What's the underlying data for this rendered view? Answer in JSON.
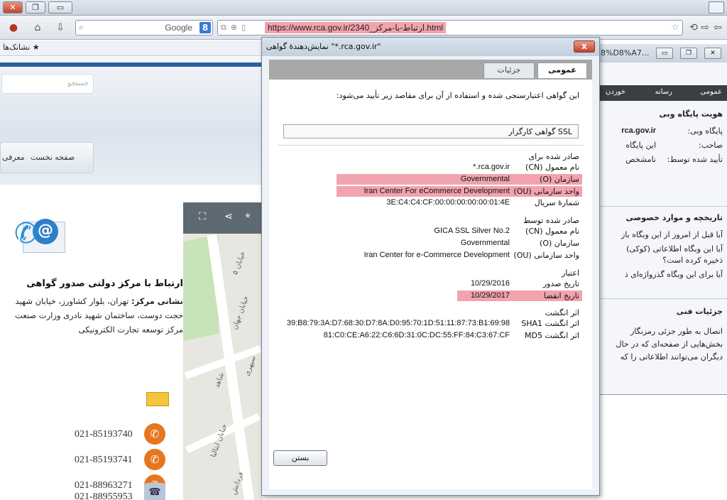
{
  "browser": {
    "url": "https://www.rca.gov.ir/2340_ارتباط-با-مرکز.html",
    "search_engine": "Google",
    "search_button": "8",
    "bookmarks_label": "نشانک‌ها"
  },
  "background_page": {
    "search_placeholder": "جستجو",
    "menu_home": "صفحه نخست",
    "menu_intro": "معرفی",
    "contact_title": "ارتباط با مرکز دولتی صدور گواهی",
    "address_label": "نشانی مرکز:",
    "address_line1": " تهران، بلوار کشاورز، خیابان شهید",
    "address_line2": "حجت دوست، ساختمان شهید نادری وزارت صنعت",
    "address_line3": "مرکز توسعه تجارت الکترونیکی",
    "phones": [
      "021-85193740",
      "021-85193741",
      "021-88963271"
    ],
    "fax": "021-88955953",
    "map_streets": [
      "خیابان ۵",
      "خیابان جهان",
      "شاهد",
      "خیابان ابتالیا",
      "فردانش",
      "سپهری"
    ]
  },
  "page_info_window": {
    "title": "8%D8%A7...",
    "tabs": [
      "عمومی",
      "رسانه",
      "خوردن"
    ],
    "identity_heading": "هویت پایگاه وبی",
    "website_label": "پایگاه وبی:",
    "website_value": "rca.gov.ir",
    "owner_label": "صاحب:",
    "owner_value": "این پایگاه",
    "verified_label": "تأیید شده توسط:",
    "verified_value": "نامشخص",
    "history_heading": "تاریخچه و موارد خصوصی",
    "history_q1": "آیا قبل از امروز از این وبگاه باز",
    "history_q2": "آیا این وبگاه اطلاعاتی (کوکی)",
    "history_q2b": "ذخیره کرده است؟",
    "history_q3": "آیا برای این وبگاه گذرواژه‌ای ذ",
    "tech_heading": "جزئیات فنی",
    "tech_l1": "اتصال به طور جزئی رمزنگار",
    "tech_l2": "بخش‌هایی از صفحه‌ای که در حال",
    "tech_l3": "دیگران می‌توانند اطلاعاتی را که"
  },
  "certificate_dialog": {
    "title": "نمایش‌دهندهٔ گواهی \"*.rca.gov.ir\"",
    "close_x": "x",
    "tabs": {
      "general": "عمومی",
      "details": "جزئیات"
    },
    "verified_text": "این گواهی اعتبارسنجی شده و استفاده از آن برای مقاصد زیر تأیید می‌شود:",
    "purpose": "گواهی کارگزار SSL",
    "issued_to": {
      "heading": "صادر شده برای",
      "cn_label": "نام معمول (CN)",
      "cn_value": "*.rca.gov.ir",
      "o_label": "سازمان (O)",
      "o_value": "Governmental",
      "ou_label": "واحد سازمانی (OU)",
      "ou_value": "Iran Center For eCommerce Development",
      "serial_label": "شمارهٔ سریال",
      "serial_value": "3E:C4:C4:CF:00:00:00:00:00:01:4E"
    },
    "issued_by": {
      "heading": "صادر شده توسط",
      "cn_label": "نام معمول (CN)",
      "cn_value": "GICA SSL Silver No.2",
      "o_label": "سازمان (O)",
      "o_value": "Governmental",
      "ou_label": "واحد سازمانی (OU)",
      "ou_value": "Iran Center for e-Commerce Development"
    },
    "validity": {
      "heading": "اعتبار",
      "issued_label": "تاریخ صدور",
      "issued_value": "10/29/2016",
      "expires_label": "تاریخ انقضا",
      "expires_value": "10/29/2017"
    },
    "fingerprints": {
      "heading": "اثر انگشت",
      "sha1_label": "اثر انگشت SHA1",
      "sha1_value": "39:B8:79:3A:D7:68:30:D7:8A:D0:95:70:1D:51:11:87:73:B1:69:98",
      "md5_label": "اثر انگشت MD5",
      "md5_value": "81:C0:CE:A6:22:C6:6D:31:0C:DC:55:FF:84:C3:67:CF"
    },
    "close_button": "بستن"
  },
  "colors": {
    "highlight": "#f2a3ad",
    "accent_orange": "#e6761f",
    "map_green": "#c7e3b7"
  }
}
